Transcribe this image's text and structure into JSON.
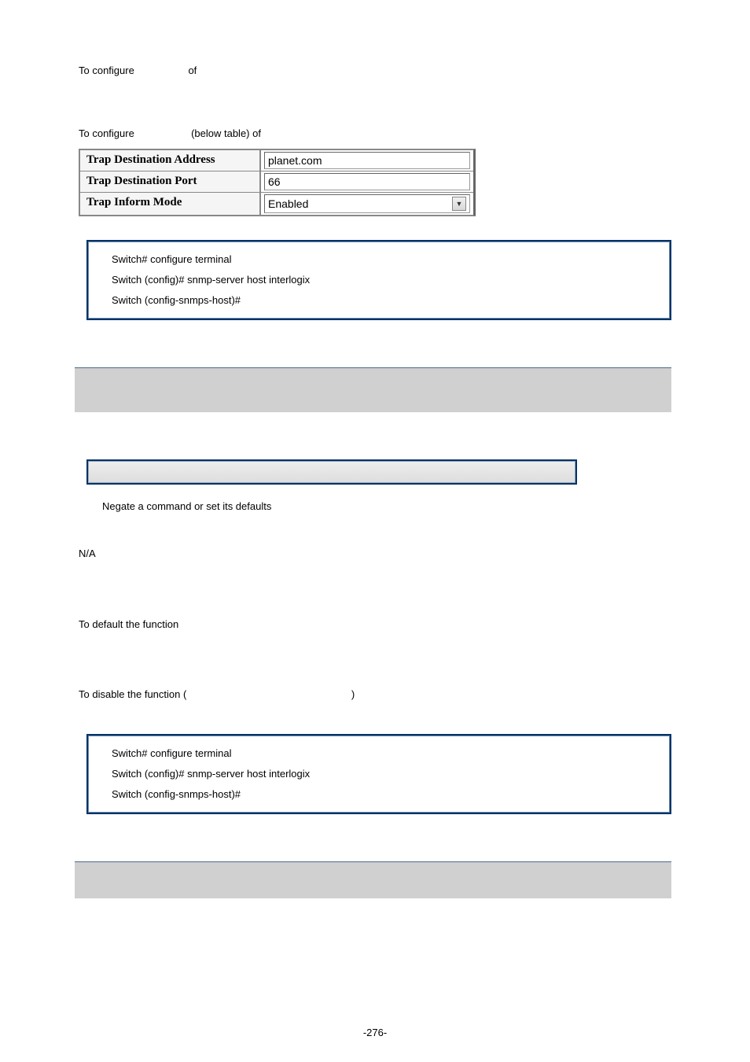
{
  "lines": {
    "line1_a": "To configure",
    "line1_b": "of",
    "line2_a": "To configure",
    "line2_b": "(below table) of"
  },
  "form": {
    "rows": [
      {
        "label": "Trap Destination Address",
        "value": "planet.com",
        "type": "text"
      },
      {
        "label": "Trap Destination Port",
        "value": "66",
        "type": "text"
      },
      {
        "label": "Trap Inform Mode",
        "value": "Enabled",
        "type": "select"
      }
    ]
  },
  "example1": {
    "l1": "Switch# configure terminal",
    "l2": "Switch (config)# snmp-server host interlogix",
    "l3": "Switch (config-snmps-host)#"
  },
  "negate_desc": "Negate a command or set its defaults",
  "default_na": "N/A",
  "usage_default": "To default the function",
  "usage_disable_a": "To disable the function (",
  "usage_disable_b": ")",
  "example2": {
    "l1": "Switch# configure terminal",
    "l2": "Switch (config)# snmp-server host interlogix",
    "l3": "Switch (config-snmps-host)#"
  },
  "page_number": "-276-"
}
